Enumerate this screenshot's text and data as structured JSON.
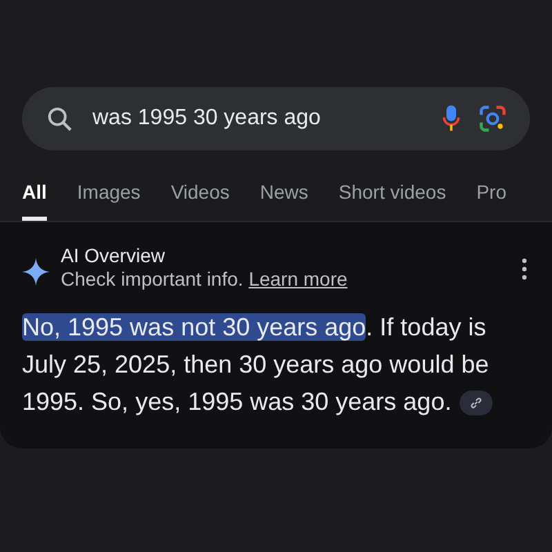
{
  "search": {
    "value": "was 1995 30 years ago"
  },
  "tabs": [
    {
      "label": "All",
      "selected": true
    },
    {
      "label": "Images",
      "selected": false
    },
    {
      "label": "Videos",
      "selected": false
    },
    {
      "label": "News",
      "selected": false
    },
    {
      "label": "Short videos",
      "selected": false
    },
    {
      "label": "Pro",
      "selected": false
    }
  ],
  "overview": {
    "title": "AI Overview",
    "note": "Check important info.",
    "link": "Learn more",
    "highlighted": "No, 1995 was not 30 years ago",
    "rest": ". If today is July 25, 2025, then 30 years ago would be 1995. So, yes, 1995 was 30 years ago."
  }
}
